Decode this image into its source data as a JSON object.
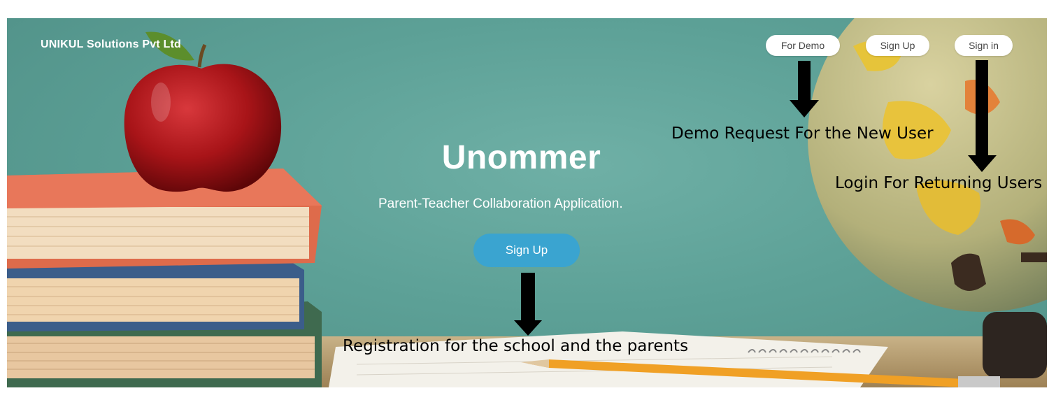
{
  "header": {
    "brand": "UNIKUL Solutions Pvt Ltd",
    "nav": {
      "demo_label": "For Demo",
      "signup_label": "Sign Up",
      "signin_label": "Sign in"
    }
  },
  "hero": {
    "title": "Unommer",
    "subtitle": "Parent-Teacher Collaboration Application.",
    "cta_label": "Sign Up"
  },
  "annotations": {
    "demo": "Demo Request For the New User",
    "login": "Login For Returning Users",
    "registration": "Registration for the school and the parents"
  },
  "colors": {
    "board": "#5da197",
    "cta": "#3aa4d0",
    "annotation_text": "#000000"
  }
}
